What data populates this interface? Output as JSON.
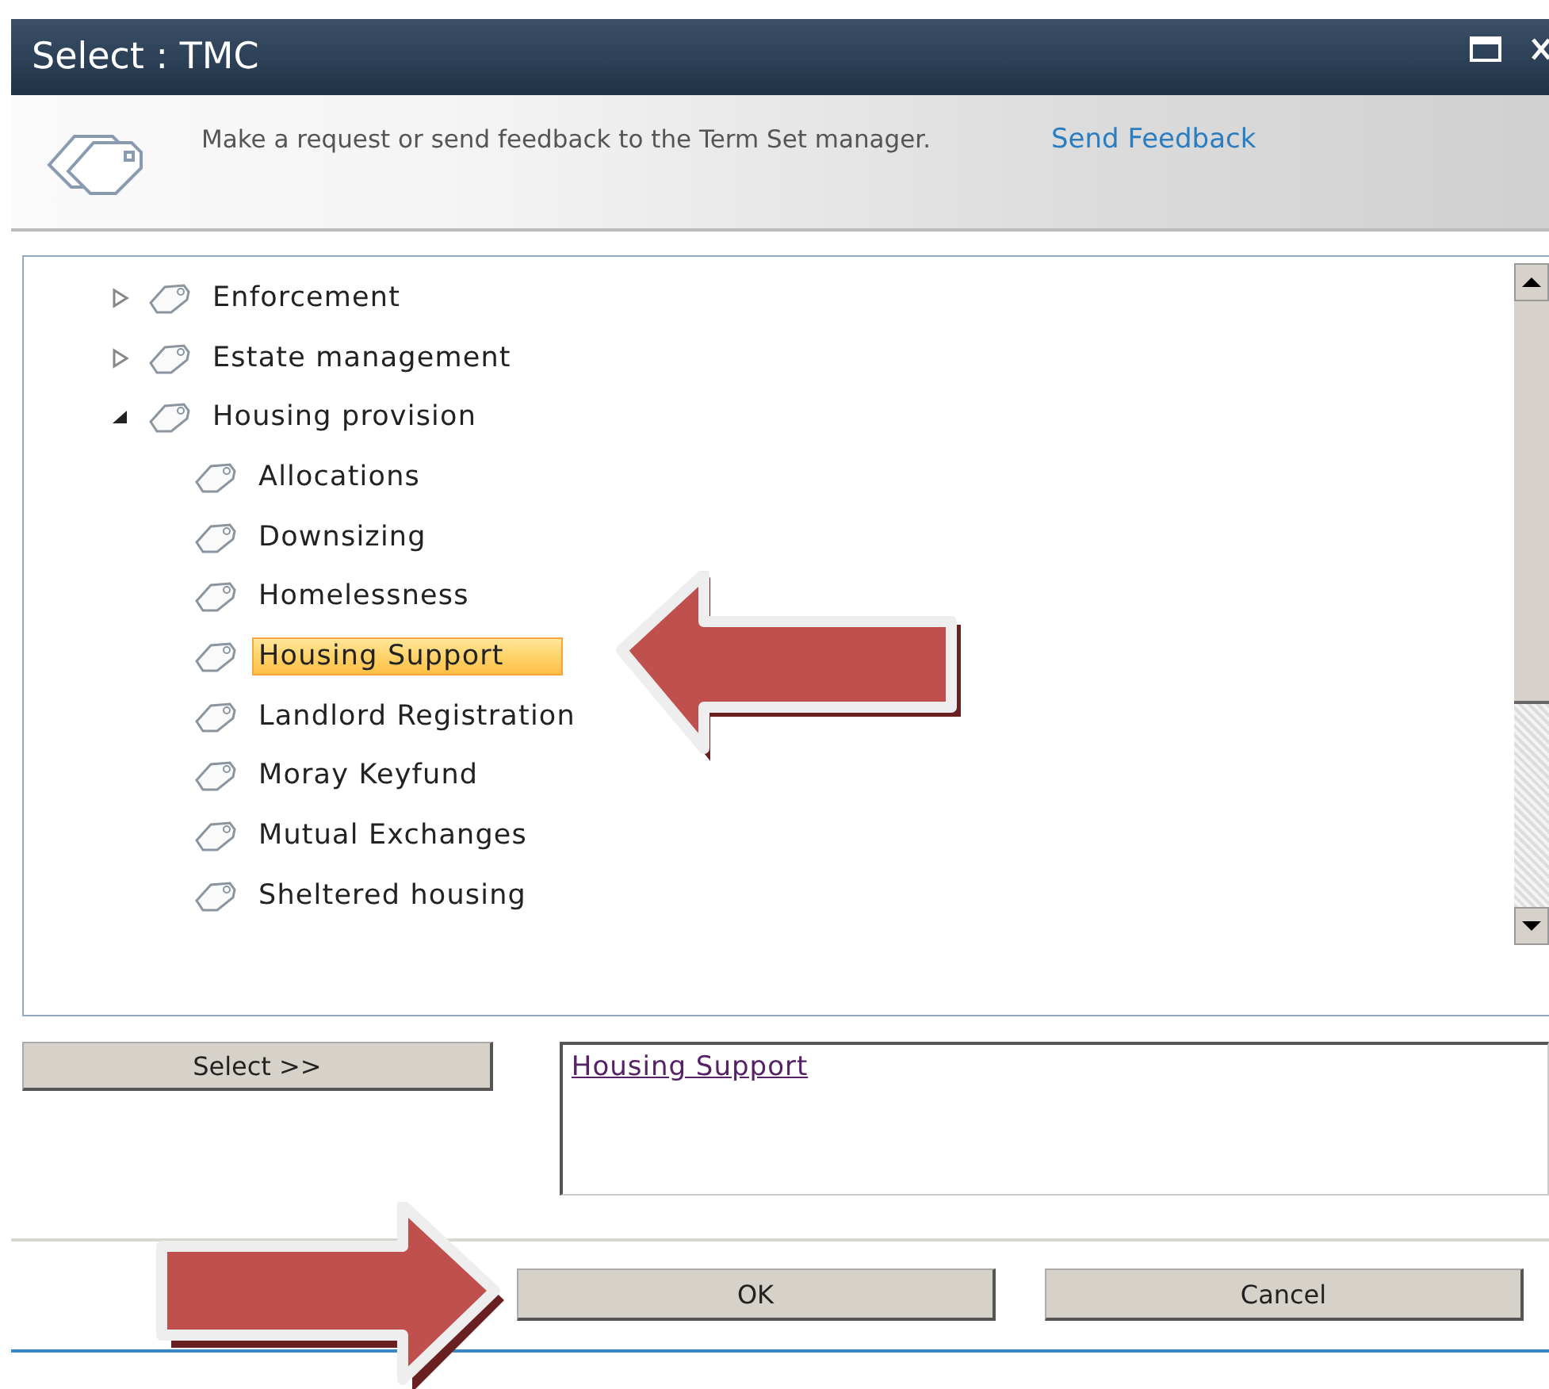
{
  "window": {
    "title": "Select : TMC"
  },
  "header": {
    "message": "Make a request or send feedback to the Term Set manager.",
    "link": "Send Feedback"
  },
  "tree": {
    "items": [
      {
        "label": "Enforcement",
        "expanded": false,
        "selected": false
      },
      {
        "label": "Estate management",
        "expanded": false,
        "selected": false
      },
      {
        "label": "Housing provision",
        "expanded": true,
        "selected": false,
        "children": [
          {
            "label": "Allocations",
            "selected": false
          },
          {
            "label": "Downsizing",
            "selected": false
          },
          {
            "label": "Homelessness",
            "selected": false
          },
          {
            "label": "Housing Support",
            "selected": true
          },
          {
            "label": "Landlord Registration",
            "selected": false
          },
          {
            "label": "Moray Keyfund",
            "selected": false
          },
          {
            "label": "Mutual Exchanges",
            "selected": false
          },
          {
            "label": "Sheltered housing",
            "selected": false
          }
        ]
      }
    ]
  },
  "selection": {
    "button": "Select >>",
    "value": "Housing Support"
  },
  "buttons": [
    "OK",
    "Cancel"
  ],
  "callouts": [
    {
      "kind": "leftarrow"
    },
    {
      "kind": "rightarrow"
    }
  ]
}
